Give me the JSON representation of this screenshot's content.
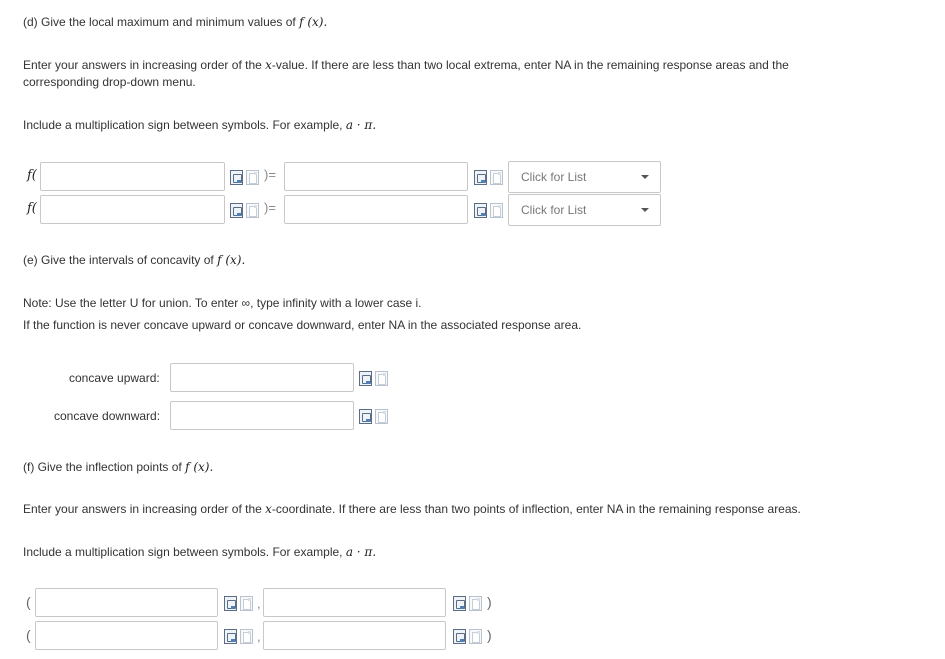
{
  "part_d": {
    "heading_prefix": "(d) Give the local maximum and minimum values of ",
    "heading_math": "f (x).",
    "instr1_a": "Enter your answers in increasing order of the ",
    "instr1_math": "x",
    "instr1_b": "-value. If there are less than two local extrema, enter NA in the remaining response areas and the",
    "instr1_line2": "corresponding drop-down menu.",
    "instr2": "Include a multiplication sign between symbols. For example, ",
    "instr2_math": "a · π.",
    "func_open": "f(",
    "func_close": ")=",
    "rows": [
      {
        "dropdown_placeholder": "Click for List"
      },
      {
        "dropdown_placeholder": "Click for List"
      }
    ]
  },
  "part_e": {
    "heading_prefix": "(e) Give the intervals of concavity of ",
    "heading_math": "f (x).",
    "note1": "Note: Use the letter U for union. To enter ∞, type infinity with a lower case i.",
    "note2": "If the function is never concave upward or concave downward, enter NA in the associated response area.",
    "label_up": "concave upward:",
    "label_down": "concave downward:"
  },
  "part_f": {
    "heading_prefix": "(f) Give the inflection points of ",
    "heading_math": "f (x).",
    "instr1_a": "Enter your answers in increasing order of the ",
    "instr1_math": "x",
    "instr1_b": "-coordinate. If there are less than two points of inflection, enter NA in the remaining response areas.",
    "instr2": "Include a multiplication sign between symbols. For example, ",
    "instr2_math": "a · π.",
    "paren_open": "(",
    "comma": ",",
    "paren_close": ")"
  }
}
